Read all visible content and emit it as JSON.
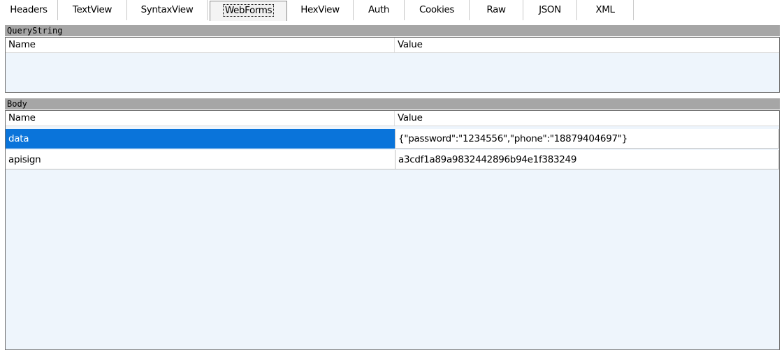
{
  "tabs": [
    {
      "label": "Headers",
      "active": false
    },
    {
      "label": "TextView",
      "active": false
    },
    {
      "label": "SyntaxView",
      "active": false
    },
    {
      "label": "WebForms",
      "active": true
    },
    {
      "label": "HexView",
      "active": false
    },
    {
      "label": "Auth",
      "active": false
    },
    {
      "label": "Cookies",
      "active": false
    },
    {
      "label": "Raw",
      "active": false
    },
    {
      "label": "JSON",
      "active": false
    },
    {
      "label": "XML",
      "active": false
    }
  ],
  "querystring": {
    "title": "QueryString",
    "col_name": "Name",
    "col_value": "Value",
    "rows": []
  },
  "body": {
    "title": "Body",
    "col_name": "Name",
    "col_value": "Value",
    "rows": [
      {
        "name": "data",
        "value": "{\"password\":\"1234556\",\"phone\":\"18879404697\"}",
        "selected": true
      },
      {
        "name": "apisign",
        "value": "a3cdf1a89a9832442896b94e1f383249",
        "selected": false
      }
    ]
  },
  "colors": {
    "selection": "#0a74da",
    "list_background": "#eef5fc",
    "section_bar": "#a6a6a6"
  }
}
